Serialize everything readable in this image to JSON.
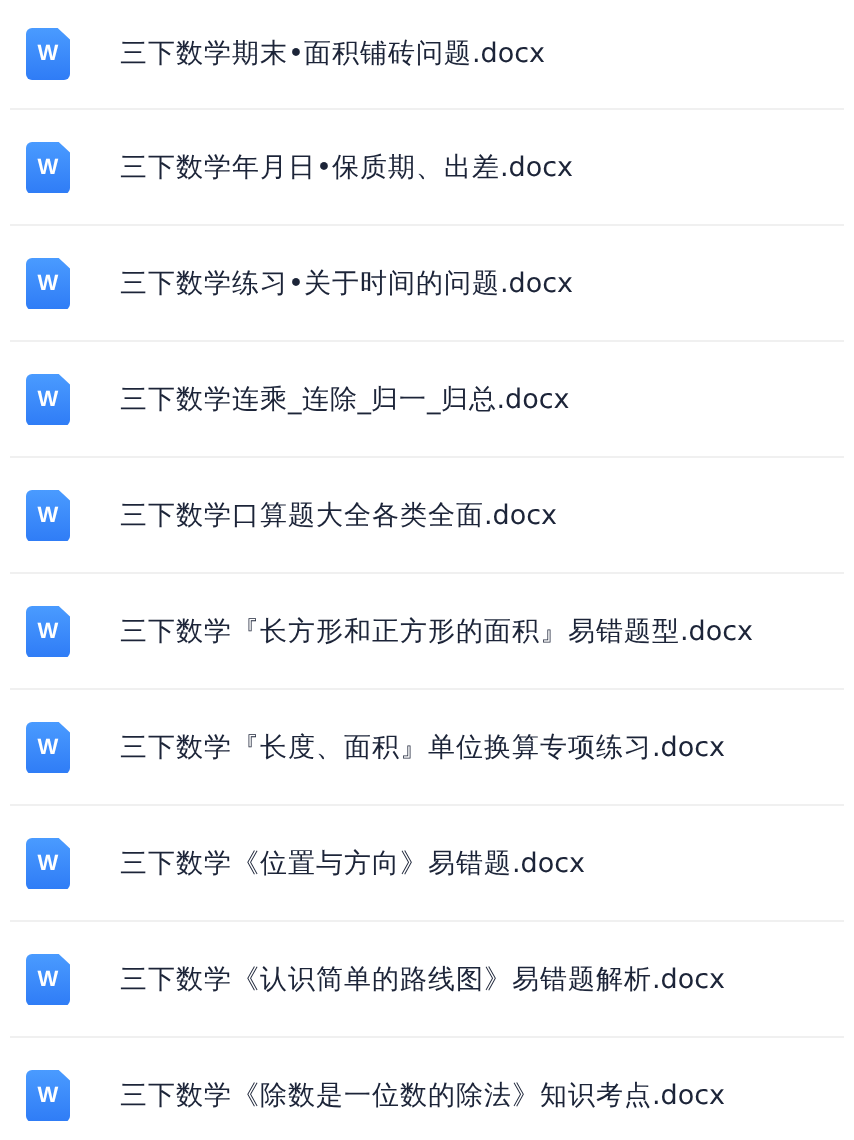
{
  "files": [
    {
      "icon_letter": "W",
      "name": "三下数学期末•面积铺砖问题.docx"
    },
    {
      "icon_letter": "W",
      "name": "三下数学年月日•保质期、出差.docx"
    },
    {
      "icon_letter": "W",
      "name": "三下数学练习•关于时间的问题.docx"
    },
    {
      "icon_letter": "W",
      "name": "三下数学连乘_连除_归一_归总.docx"
    },
    {
      "icon_letter": "W",
      "name": "三下数学口算题大全各类全面.docx"
    },
    {
      "icon_letter": "W",
      "name": "三下数学『长方形和正方形的面积』易错题型.docx"
    },
    {
      "icon_letter": "W",
      "name": "三下数学『长度、面积』单位换算专项练习.docx"
    },
    {
      "icon_letter": "W",
      "name": "三下数学《位置与方向》易错题.docx"
    },
    {
      "icon_letter": "W",
      "name": "三下数学《认识简单的路线图》易错题解析.docx"
    },
    {
      "icon_letter": "W",
      "name": "三下数学《除数是一位数的除法》知识考点.docx"
    }
  ]
}
